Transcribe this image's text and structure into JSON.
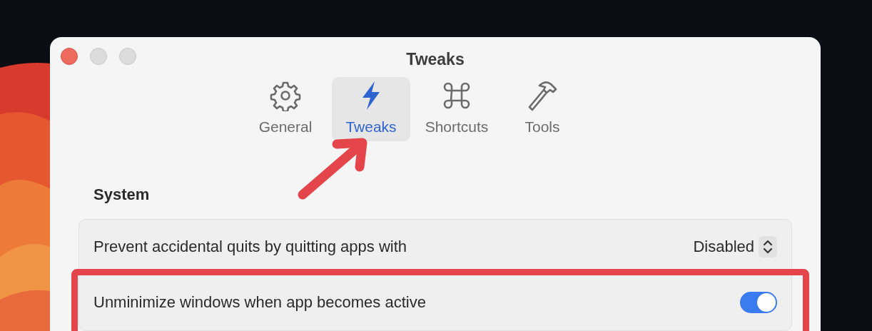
{
  "window": {
    "title": "Tweaks"
  },
  "tabs": [
    {
      "kind": "gear",
      "label": "General",
      "selected": false
    },
    {
      "kind": "bolt",
      "label": "Tweaks",
      "selected": true
    },
    {
      "kind": "command",
      "label": "Shortcuts",
      "selected": false
    },
    {
      "kind": "hammer",
      "label": "Tools",
      "selected": false
    }
  ],
  "section": {
    "title": "System"
  },
  "settings": [
    {
      "kind": "popup",
      "label": "Prevent accidental quits by quitting apps with",
      "value": "Disabled"
    },
    {
      "kind": "toggle",
      "label": "Unminimize windows when app becomes active",
      "on": true
    }
  ]
}
